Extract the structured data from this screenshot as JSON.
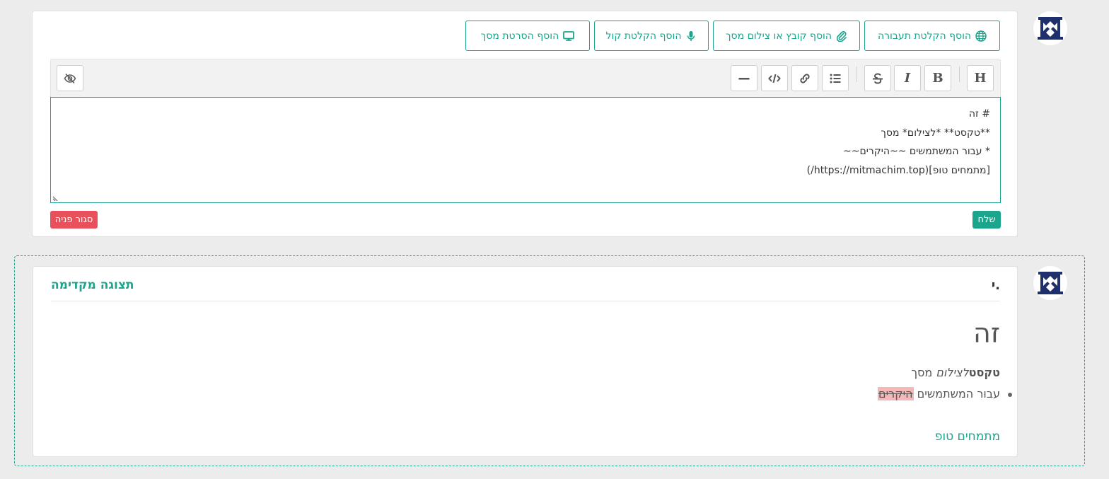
{
  "editor": {
    "attachments": [
      {
        "label": "הוסף הקלטת תעבורה",
        "icon": "globe-icon"
      },
      {
        "label": "הוסף קובץ או צילום מסך",
        "icon": "paperclip-icon"
      },
      {
        "label": "הוסף הקלטת קול",
        "icon": "microphone-icon"
      },
      {
        "label": "הוסף הסרטת מסך",
        "icon": "monitor-icon"
      }
    ],
    "toolbar": {
      "heading": "H",
      "bold": "B",
      "italic": "I"
    },
    "text_lines": [
      "# זה",
      "**טקסט** *לצילום* מסך",
      "* עבור המשתמשים ~~היקרים~~",
      "[מתמחים טופ](https://mitmachim.top/)"
    ],
    "send_label": "שלח",
    "close_label": "סגור פניה"
  },
  "preview": {
    "author": "י.",
    "label": "תצוגה מקדימה",
    "heading": "זה",
    "paragraph": {
      "bold": "טקסט",
      "italic": "לצילום",
      "rest": " מסך"
    },
    "list_item": {
      "text": "עבור המשתמשים ",
      "struck": "היקרים"
    },
    "link": "מתמחים טופ"
  },
  "colors": {
    "accent": "#1aa58c",
    "danger": "#e8505b",
    "strike_bg": "#f5b8b8"
  }
}
